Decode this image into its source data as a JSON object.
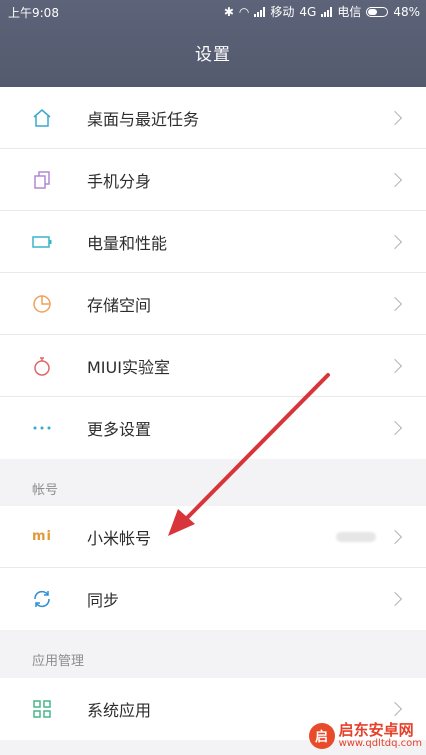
{
  "status_bar": {
    "time": "上午9:08",
    "carrier1": "移动",
    "network": "4G",
    "carrier2": "电信",
    "battery": "48%"
  },
  "header": {
    "title": "设置"
  },
  "group1": {
    "items": [
      {
        "label": "桌面与最近任务",
        "icon": "home-icon",
        "icon_color": "#39a8c9"
      },
      {
        "label": "手机分身",
        "icon": "clone-icon",
        "icon_color": "#b18ad6"
      },
      {
        "label": "电量和性能",
        "icon": "battery-icon",
        "icon_color": "#39b6c7"
      },
      {
        "label": "存储空间",
        "icon": "pie-icon",
        "icon_color": "#f0a15a"
      },
      {
        "label": "MIUI实验室",
        "icon": "flask-icon",
        "icon_color": "#e0666a"
      },
      {
        "label": "更多设置",
        "icon": "more-icon",
        "icon_color": "#3aa5d8"
      }
    ]
  },
  "account_section": {
    "title": "帐号",
    "items": [
      {
        "label": "小米帐号",
        "icon": "mi-logo-icon",
        "icon_text": "mi",
        "icon_color": "#e09a3a"
      },
      {
        "label": "同步",
        "icon": "sync-icon",
        "icon_color": "#2d8fd6"
      }
    ]
  },
  "apps_section": {
    "title": "应用管理",
    "items": [
      {
        "label": "系统应用",
        "icon": "grid-icon",
        "icon_color": "#48b58a"
      }
    ]
  },
  "watermark": {
    "brand": "启东安卓网",
    "url": "www.qdltdq.com",
    "badge": "启"
  },
  "annotation_color": "#d8353a"
}
